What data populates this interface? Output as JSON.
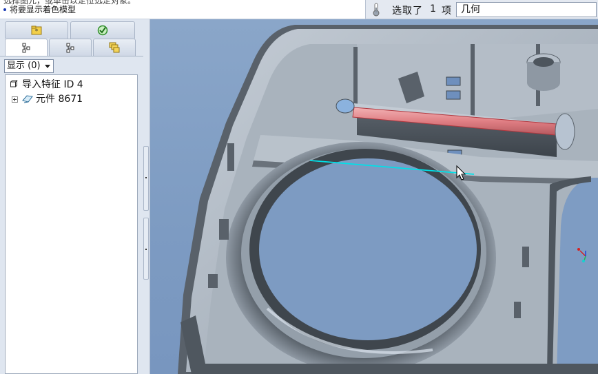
{
  "message_area": {
    "line_top": "选择图元，或单击以定位选定对象。",
    "line_main": "将要显示着色模型"
  },
  "selection_bar": {
    "selected_prefix": "选取了",
    "selected_count": "1",
    "selected_unit": "项",
    "filter_value": "几何"
  },
  "navigator": {
    "show_button_label": "显示 (0)",
    "tabs_top": [
      "folder-star-icon",
      "favorites-icon"
    ],
    "tabs_bottom": [
      "model-tree-icon",
      "layer-tree-icon",
      "folder-browser-icon"
    ],
    "tree": [
      {
        "label": "导入特征 ID 4",
        "icon": "part-icon",
        "expandable": false
      },
      {
        "label": "元件 8671",
        "icon": "component-icon",
        "expandable": true
      }
    ]
  },
  "colors": {
    "viewport_background": "#7e9cc3",
    "model_surface": "#aeb8c2",
    "model_shadow": "#4c545c",
    "selected_edge": "#00e0e8",
    "highlight_feature": "#e07f84"
  }
}
